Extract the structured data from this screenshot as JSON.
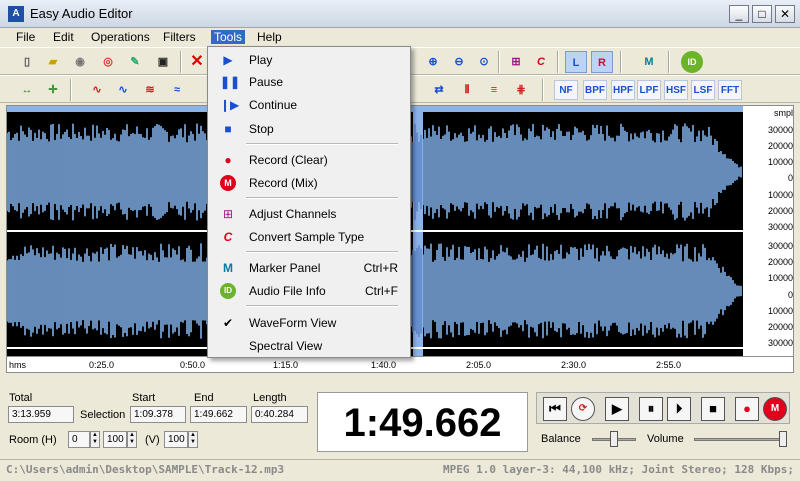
{
  "window": {
    "title": "Easy Audio Editor",
    "min": "_",
    "max": "□",
    "close": "✕"
  },
  "menu": [
    "File",
    "Edit",
    "Operations",
    "Filters",
    "Tools",
    "Help"
  ],
  "filter_buttons": [
    "NF",
    "BPF",
    "HPF",
    "LPF",
    "HSF",
    "LSF",
    "FFT"
  ],
  "tools_menu": {
    "play": "Play",
    "pause": "Pause",
    "continue": "Continue",
    "stop": "Stop",
    "record_clear": "Record (Clear)",
    "record_mix": "Record (Mix)",
    "adjust_channels": "Adjust Channels",
    "convert_sample_type": "Convert  Sample Type",
    "marker_panel": "Marker Panel",
    "marker_panel_shortcut": "Ctrl+R",
    "audio_file_info": "Audio File Info",
    "audio_file_info_shortcut": "Ctrl+F",
    "waveform_view": "WaveForm View",
    "spectral_view": "Spectral View"
  },
  "scale": {
    "unit": "smpl",
    "labels": [
      "30000",
      "20000",
      "10000",
      "0",
      "10000",
      "20000",
      "30000"
    ]
  },
  "ruler": {
    "unit": "hms",
    "ticks": [
      "0:25.0",
      "0:50.0",
      "1:15.0",
      "1:40.0",
      "2:05.0",
      "2:30.0",
      "2:55.0"
    ]
  },
  "info": {
    "total_label": "Total",
    "total": "3:13.959",
    "selection_label": "Selection",
    "start_label": "Start",
    "start": "1:09.378",
    "end_label": "End",
    "end": "1:49.662",
    "length_label": "Length",
    "length": "0:40.284",
    "room_label": "Room (H)",
    "room_h": "0",
    "room_h_zoom": "100",
    "room_v_label": "(V)",
    "room_v": "100"
  },
  "current_time": "1:49.662",
  "transport": {
    "balance_label": "Balance",
    "volume_label": "Volume",
    "balance": 0.5,
    "volume": 0.97
  },
  "status": {
    "path": "C:\\Users\\admin\\Desktop\\SAMPLE\\Track-12.mp3",
    "format": "MPEG 1.0 layer-3: 44,100 kHz; Joint Stereo; 128 Kbps;"
  },
  "colors": {
    "wave_bg": "#000000",
    "selection": "#8ab4e8",
    "accent_blue": "#1a4fd0",
    "record_red": "#e0001b"
  }
}
